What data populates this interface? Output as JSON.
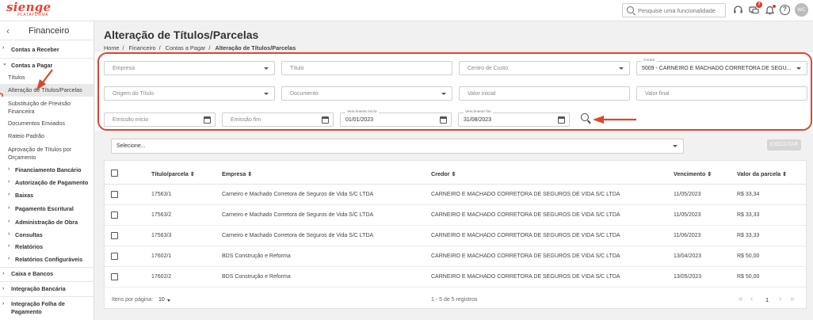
{
  "topbar": {
    "logo_main": "sienge",
    "logo_sub": "PLATAFORMA",
    "search_placeholder": "Pesquise uma funcionalidade",
    "notification_count": "7",
    "user_initials": "WC"
  },
  "sidebar": {
    "title": "Financeiro",
    "items": [
      {
        "label": "Contas a Receber",
        "chevron": "›",
        "style": "bold"
      },
      {
        "label": "Contas a Pagar",
        "chevron": "⌄",
        "style": "bold"
      },
      {
        "label": "Títulos",
        "style": "normal"
      },
      {
        "label": "Alteração de Títulos/Parcelas",
        "style": "active"
      },
      {
        "label": "Substituição de Previsão Financeira",
        "style": "normal"
      },
      {
        "label": "Documentos Enviados",
        "style": "normal"
      },
      {
        "label": "Rateio Padrão",
        "style": "normal"
      },
      {
        "label": "Aprovação de Títulos por Orçamento",
        "style": "normal"
      },
      {
        "label": "Financiamento Bancário",
        "chevron": "›",
        "style": "sub"
      },
      {
        "label": "Autorização de Pagamento",
        "chevron": "›",
        "style": "sub"
      },
      {
        "label": "Baixas",
        "chevron": "›",
        "style": "sub"
      },
      {
        "label": "Pagamento Escritural",
        "chevron": "›",
        "style": "sub"
      },
      {
        "label": "Administração de Obra",
        "chevron": "›",
        "style": "sub"
      },
      {
        "label": "Consultas",
        "chevron": "›",
        "style": "sub"
      },
      {
        "label": "Relatórios",
        "chevron": "›",
        "style": "sub"
      },
      {
        "label": "Relatórios Configuráveis",
        "chevron": "›",
        "style": "sub"
      },
      {
        "label": "Caixa e Bancos",
        "chevron": "›",
        "style": "bold"
      },
      {
        "label": "Integração Bancária",
        "chevron": "›",
        "style": "bold"
      },
      {
        "label": "Integração Folha de Pagamento",
        "chevron": "›",
        "style": "bold"
      }
    ]
  },
  "page": {
    "title": "Alteração de Títulos/Parcelas",
    "breadcrumb": [
      "Home",
      "Financeiro",
      "Contas a Pagar",
      "Alteração de Títulos/Parcelas"
    ]
  },
  "filters": {
    "empresa": "Empresa",
    "titulo": "Título",
    "centro_custo": "Centro de Custo",
    "credor_label": "Credor",
    "credor_value": "5009 - CARNEIRO E MACHADO CORRETORA DE SEGU...",
    "origem": "Origem do Título",
    "documento": "Documento",
    "valor_inicial": "Valor inicial",
    "valor_final": "Valor final",
    "emissao_inicio": "Emissão início",
    "emissao_fim": "Emissão fim",
    "venc_inicio_label": "Vencimento início",
    "venc_inicio_value": "01/01/2023",
    "venc_fim_label": "Vencimento fim",
    "venc_fim_value": "31/08/2023"
  },
  "actions": {
    "select_value": "Selecione...",
    "execute_label": "EXECUTAR"
  },
  "table": {
    "headers": {
      "titulo": "Título/parcela ⇕",
      "empresa": "Empresa ⇕",
      "credor": "Credor ⇕",
      "vencimento": "Vencimento ⇕",
      "valor": "Valor da parcela ⇕"
    },
    "rows": [
      {
        "titulo": "17563/1",
        "empresa": "Carneiro e Machado Corretora de Seguros de Vida S/C LTDA",
        "credor": "CARNEIRO E MACHADO CORRETORA DE SEGUROS DE VIDA S/C LTDA",
        "vencimento": "11/05/2023",
        "valor": "R$ 33,34"
      },
      {
        "titulo": "17563/2",
        "empresa": "Carneiro e Machado Corretora de Seguros de Vida S/C LTDA",
        "credor": "CARNEIRO E MACHADO CORRETORA DE SEGUROS DE VIDA S/C LTDA",
        "vencimento": "11/05/2023",
        "valor": "R$ 33,33"
      },
      {
        "titulo": "17563/3",
        "empresa": "Carneiro e Machado Corretora de Seguros de Vida S/C LTDA",
        "credor": "CARNEIRO E MACHADO CORRETORA DE SEGUROS DE VIDA S/C LTDA",
        "vencimento": "11/06/2023",
        "valor": "R$ 33,33"
      },
      {
        "titulo": "17602/1",
        "empresa": "BDS Construção e Reforma",
        "credor": "CARNEIRO E MACHADO CORRETORA DE SEGUROS DE VIDA S/C LTDA",
        "vencimento": "13/04/2023",
        "valor": "R$ 50,00"
      },
      {
        "titulo": "17602/2",
        "empresa": "BDS Construção e Reforma",
        "credor": "CARNEIRO E MACHADO CORRETORA DE SEGUROS DE VIDA S/C LTDA",
        "vencimento": "13/05/2023",
        "valor": "R$ 50,00"
      }
    ],
    "footer": {
      "per_page_label": "Itens por página:",
      "per_page_value": "10",
      "range": "1 - 5 de 5 registros",
      "current_page": "1"
    }
  },
  "colors": {
    "brand": "#e8402f",
    "highlight": "#e0442f",
    "active_item": "#e9e9e9"
  }
}
